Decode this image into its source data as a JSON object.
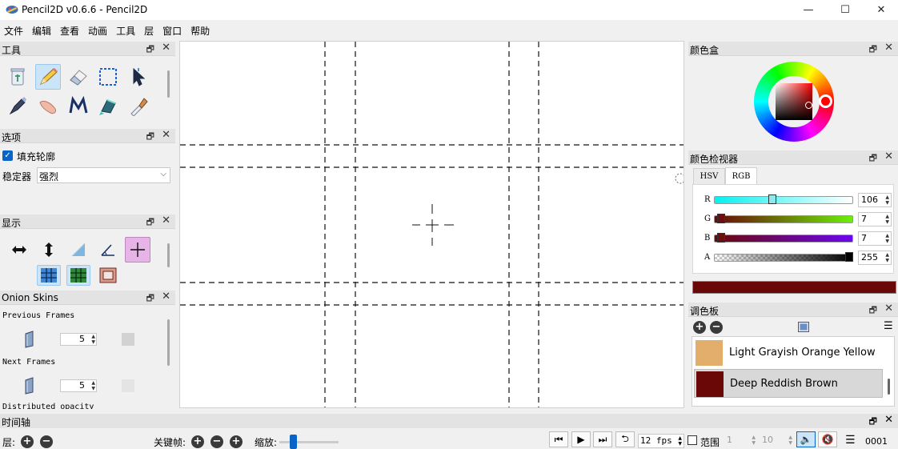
{
  "window": {
    "title": "Pencil2D v0.6.6 - Pencil2D",
    "minimize": "—",
    "maximize": "☐",
    "close": "✕"
  },
  "menu": [
    "文件",
    "编辑",
    "查看",
    "动画",
    "工具",
    "层",
    "窗口",
    "帮助"
  ],
  "tools_panel": {
    "title": "工具"
  },
  "options_panel": {
    "title": "选项",
    "fill_contour_label": "填充轮廓",
    "stabilizer_label": "稳定器",
    "stabilizer_value": "强烈"
  },
  "display_panel": {
    "title": "显示"
  },
  "onion_panel": {
    "title": "Onion Skins",
    "previous_label": "Previous Frames",
    "previous_value": "5",
    "next_label": "Next Frames",
    "next_value": "5",
    "distributed_label": "Distributed opacity"
  },
  "color_box": {
    "title": "颜色盒"
  },
  "color_inspector": {
    "title": "颜色检视器",
    "tabs": [
      "HSV",
      "RGB"
    ],
    "channels": [
      {
        "label": "R",
        "value": "106",
        "fraction": 0.416
      },
      {
        "label": "G",
        "value": "7",
        "fraction": 0.027
      },
      {
        "label": "B",
        "value": "7",
        "fraction": 0.027
      },
      {
        "label": "A",
        "value": "255",
        "fraction": 1.0
      }
    ],
    "current_color": "#6a0707"
  },
  "palette": {
    "title": "调色板",
    "items": [
      {
        "name": "Light Grayish Orange Yellow",
        "color": "#e3ae6c"
      },
      {
        "name": "Deep Reddish Brown",
        "color": "#6a0707"
      }
    ]
  },
  "timeline": {
    "title": "时间轴",
    "layer_label": "层:",
    "keyframe_label": "关键帧:",
    "zoom_label": "缩放:",
    "fps": "12 fps",
    "range_label": "范围",
    "range_start": "1",
    "range_end": "10",
    "frame_counter": "0001"
  }
}
